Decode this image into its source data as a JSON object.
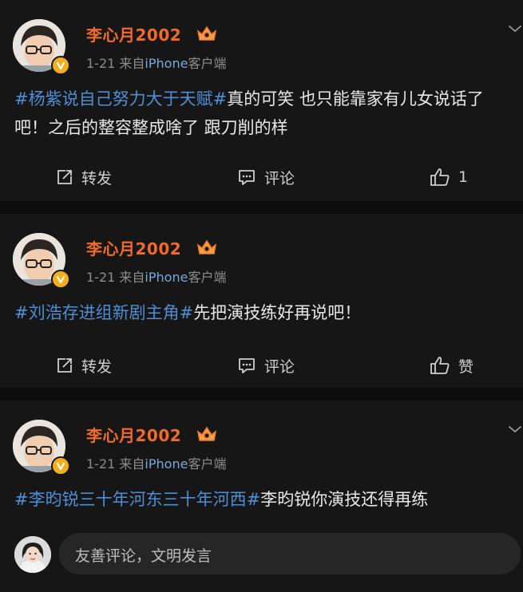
{
  "posts": [
    {
      "username": "李心月2002",
      "date": "1-21",
      "source_prefix": "来自",
      "source_device": "iPhone",
      "source_suffix": "客户端",
      "hashtag": "#杨紫说自己努力大于天赋#",
      "text": "真的可笑 也只能靠家有儿女说话了吧！之后的整容整成啥了 跟刀削的样",
      "actions": {
        "repost": "转发",
        "comment": "评论",
        "like": "1"
      }
    },
    {
      "username": "李心月2002",
      "date": "1-21",
      "source_prefix": "来自",
      "source_device": "iPhone",
      "source_suffix": "客户端",
      "hashtag": "#刘浩存进组新剧主角#",
      "text": "先把演技练好再说吧！",
      "actions": {
        "repost": "转发",
        "comment": "评论",
        "like": "赞"
      }
    },
    {
      "username": "李心月2002",
      "date": "1-21",
      "source_prefix": "来自",
      "source_device": "iPhone",
      "source_suffix": "客户端",
      "hashtag": "#李昀锐三十年河东三十年河西#",
      "text": "李昀锐你演技还得再练"
    }
  ],
  "comment_input": {
    "placeholder": "友善评论，文明发言"
  },
  "icons": {
    "repost": "share-out-icon",
    "comment": "comment-bubble-icon",
    "like": "thumbs-up-icon",
    "verified": "verified-badge-icon",
    "vip": "crown-vip-icon",
    "more": "chevron-down-icon"
  },
  "colors": {
    "background": "#0c0c0c",
    "card": "#161616",
    "username": "#f06a2c",
    "hashtag": "#4f8ed6",
    "source_link": "#7aa8d8",
    "verified": "#f2b01e"
  }
}
